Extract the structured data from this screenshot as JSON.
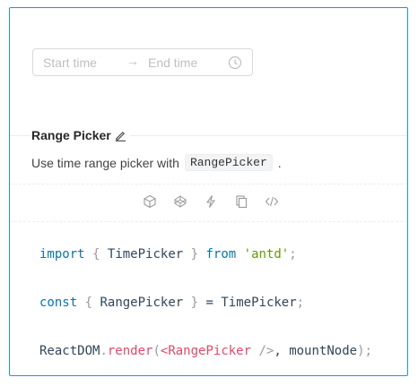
{
  "picker": {
    "start_placeholder": "Start time",
    "separator": "→",
    "end_placeholder": "End time"
  },
  "meta": {
    "title": "Range Picker",
    "desc_before": "Use time range picker with",
    "desc_code": "RangePicker",
    "desc_after": "."
  },
  "actions": [
    "codesandbox-icon",
    "codepen-icon",
    "riddle-icon",
    "copy-icon",
    "expand-code-icon"
  ],
  "code": {
    "l1_import": "import",
    "l1_open": "{",
    "l1_name": "TimePicker",
    "l1_close": "}",
    "l1_from": "from",
    "l1_src": "'antd'",
    "l1_semi": ";",
    "l2_const": "const",
    "l2_open": "{",
    "l2_name": "RangePicker",
    "l2_close": "}",
    "l2_eq": "=",
    "l2_rhs": "TimePicker",
    "l2_semi": ";",
    "l3_obj": "ReactDOM",
    "l3_dot": ".",
    "l3_fn": "render",
    "l3_paren": "(",
    "l3_tag_open": "<RangePicker",
    "l3_tag_close": "/>",
    "l3_rest": ", mountNode",
    "l3_end": ");"
  },
  "colors": {
    "card_border": "#1890ff",
    "keyword": "#0077aa",
    "string": "#669900",
    "function": "#dd4a68"
  }
}
